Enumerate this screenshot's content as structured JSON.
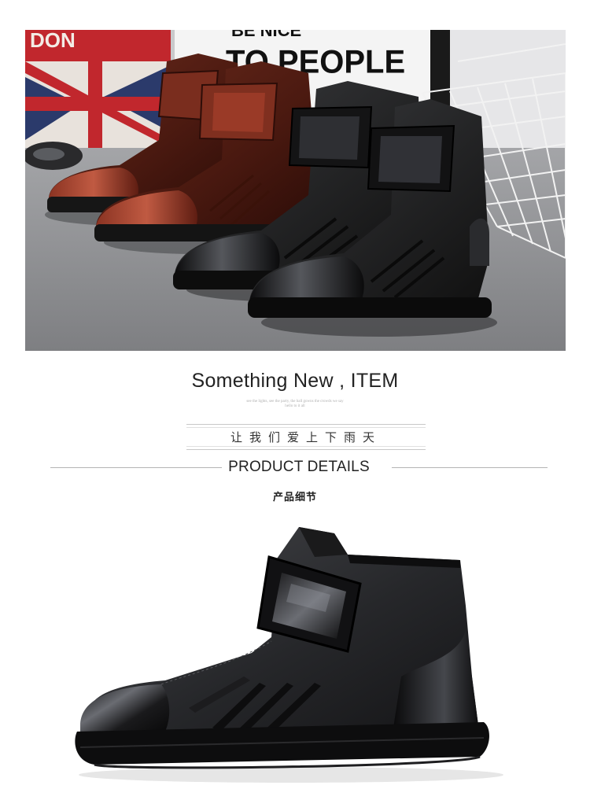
{
  "hero": {
    "poster_word_top": "BE NICE",
    "poster_word_main": "TO PEOPLE",
    "flag_word": "DON"
  },
  "headline": "Something New , ITEM",
  "fine_print": {
    "line1": "see the lights, see the party, the ball gowns the crowds we say",
    "line2": "hello to it all"
  },
  "cn_slogan": "让我们爱上下雨天",
  "details_title": "PRODUCT DETAILS",
  "details_subtitle": "产品细节",
  "colors": {
    "brown_boot": "#5a1f14",
    "black_boot": "#1c1c1e",
    "text": "#222222"
  }
}
